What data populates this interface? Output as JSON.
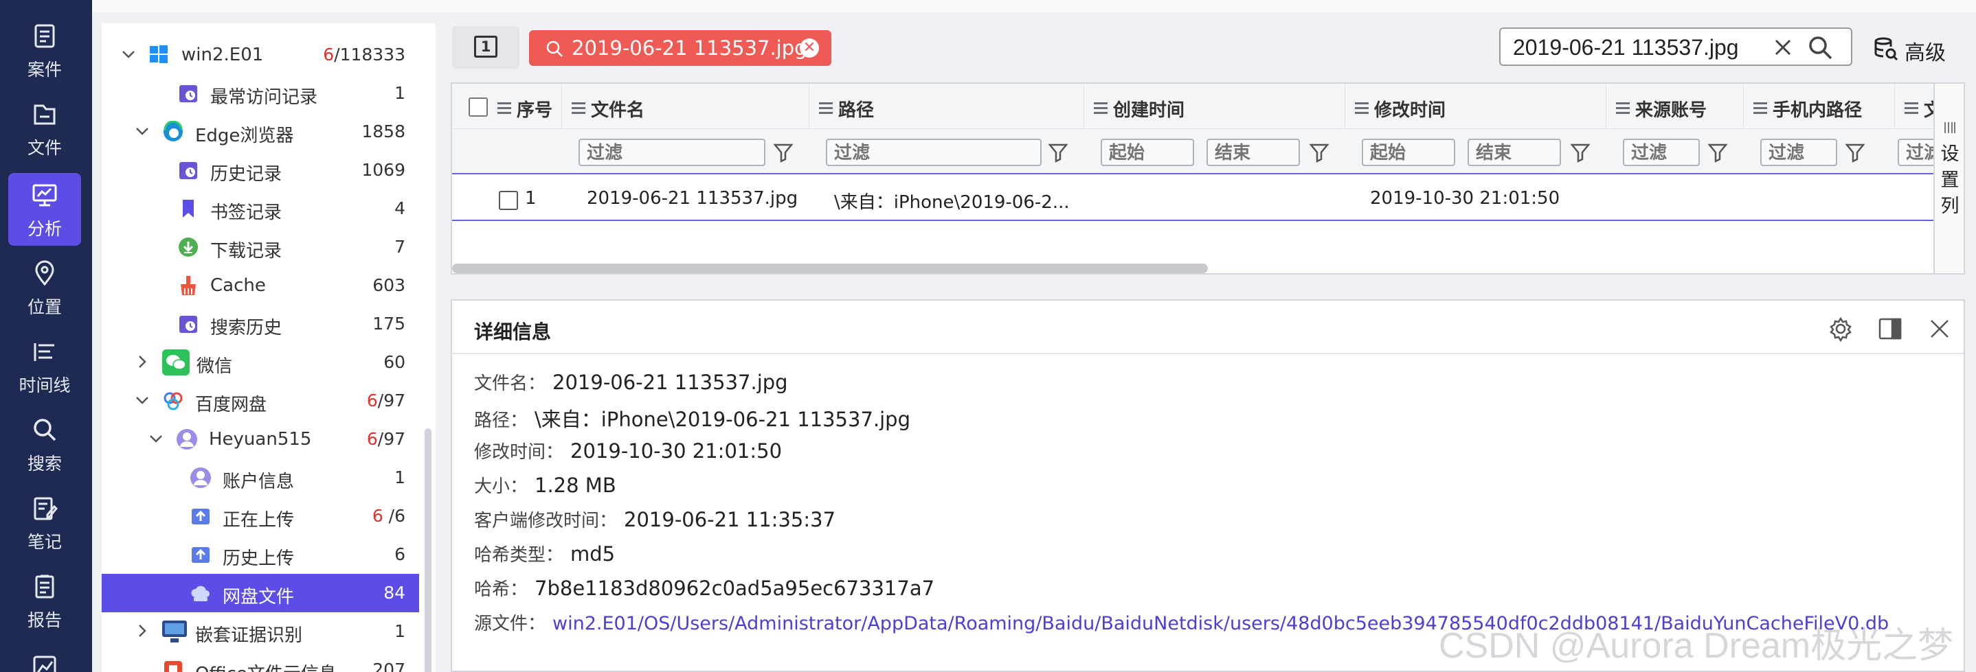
{
  "top_strip": {
    "breadcrumb": ""
  },
  "rail": {
    "items": [
      {
        "label": "案件",
        "icon": "case-icon"
      },
      {
        "label": "文件",
        "icon": "folder-icon"
      },
      {
        "label": "分析",
        "icon": "analysis-icon",
        "active": true
      },
      {
        "label": "位置",
        "icon": "location-icon"
      },
      {
        "label": "时间线",
        "icon": "timeline-icon"
      },
      {
        "label": "搜索",
        "icon": "search-icon"
      },
      {
        "label": "笔记",
        "icon": "note-icon"
      },
      {
        "label": "报告",
        "icon": "report-icon"
      }
    ]
  },
  "tree": {
    "items": [
      {
        "label": "win2.E01",
        "count_red": "6",
        "count": "/118333"
      },
      {
        "label": "最常访问记录",
        "count": "1"
      },
      {
        "label": "Edge浏览器",
        "count": "1858"
      },
      {
        "label": "历史记录",
        "count": "1069"
      },
      {
        "label": "书签记录",
        "count": "4"
      },
      {
        "label": "下载记录",
        "count": "7"
      },
      {
        "label": "Cache",
        "count": "603"
      },
      {
        "label": "搜索历史",
        "count": "175"
      },
      {
        "label": "微信",
        "count": "60"
      },
      {
        "label": "百度网盘",
        "count_red": "6",
        "count": "/97"
      },
      {
        "label": "Heyuan515",
        "count_red": "6",
        "count": "/97"
      },
      {
        "label": "账户信息",
        "count": "1"
      },
      {
        "label": "正在上传",
        "count_red": "6",
        "count": " /6"
      },
      {
        "label": "历史上传",
        "count": "6"
      },
      {
        "label": "网盘文件",
        "count": "84",
        "selected": true
      },
      {
        "label": "嵌套证据识别",
        "count": "1"
      },
      {
        "label": "Office文件元信息",
        "count": "207"
      }
    ]
  },
  "filterbar": {
    "page_number": "1",
    "tag_text": "2019-06-21 113537.jpg",
    "search_value": "2019-06-21 113537.jpg",
    "advanced_label": "高级"
  },
  "table": {
    "columns": [
      "序号",
      "文件名",
      "路径",
      "创建时间",
      "修改时间",
      "来源账号",
      "手机内路径",
      "文"
    ],
    "filter_placeholder": "过滤",
    "start_placeholder": "起始",
    "end_placeholder": "结束",
    "rows": [
      {
        "index": "1",
        "filename": "2019-06-21 113537.jpg",
        "path": "\\来自：iPhone\\2019-06-2...",
        "created": "",
        "modified": "2019-10-30 21:01:50"
      }
    ],
    "column_settings_label": "设置列"
  },
  "details": {
    "title": "详细信息",
    "fields": [
      {
        "key": "文件名：",
        "value": "2019-06-21 113537.jpg"
      },
      {
        "key": "路径：",
        "value": "\\来自：iPhone\\2019-06-21 113537.jpg"
      },
      {
        "key": "修改时间：",
        "value": "2019-10-30 21:01:50"
      },
      {
        "key": "大小：",
        "value": "1.28 MB"
      },
      {
        "key": "客户端修改时间：",
        "value": "2019-06-21 11:35:37"
      },
      {
        "key": "哈希类型：",
        "value": "md5"
      },
      {
        "key": "哈希：",
        "value": "7b8e1183d80962c0ad5a95ec673317a7"
      },
      {
        "key": "源文件：",
        "value": "win2.E01/OS/Users/Administrator/AppData/Roaming/Baidu/BaiduNetdisk/users/48d0bc5eeb394785540df0c2ddb08141/BaiduYunCacheFileV0.db",
        "link": true
      }
    ]
  },
  "watermark": "CSDN @Aurora Dream极光之梦",
  "colors": {
    "rail_bg": "#1f2a52",
    "accent": "#5b4de6",
    "tag_red": "#f05a55",
    "count_red": "#e0312b",
    "link": "#4b3fd6"
  }
}
